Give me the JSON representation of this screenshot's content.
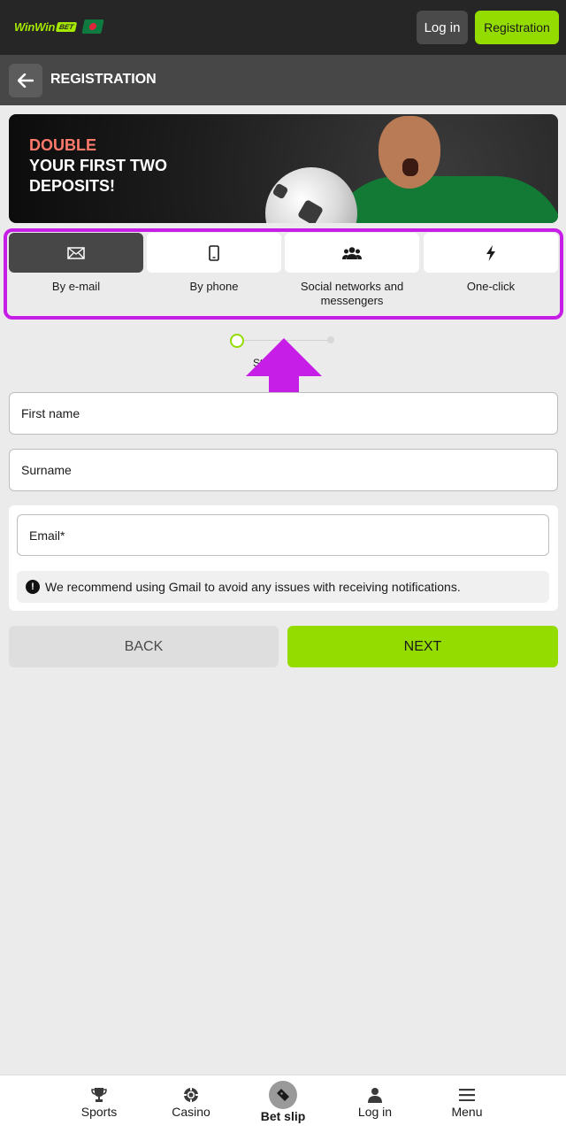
{
  "header": {
    "logo_text": "WinWin",
    "logo_badge": "BET",
    "login_label": "Log in",
    "register_label": "Registration"
  },
  "subheader": {
    "title": "REGISTRATION"
  },
  "banner": {
    "line1": "DOUBLE",
    "line2": "YOUR FIRST TWO",
    "line3": "DEPOSITS!"
  },
  "registration_types": [
    {
      "label": "By e-mail",
      "icon": "envelope-icon",
      "active": true
    },
    {
      "label": "By phone",
      "icon": "phone-icon",
      "active": false
    },
    {
      "label": "Social networks and messengers",
      "icon": "users-icon",
      "active": false
    },
    {
      "label": "One-click",
      "icon": "lightning-icon",
      "active": false
    }
  ],
  "steps": {
    "text": "Step 1 of 3"
  },
  "form": {
    "first_name_placeholder": "First name",
    "surname_placeholder": "Surname",
    "email_placeholder": "Email*",
    "hint": "We recommend using Gmail to avoid any issues with receiving notifications."
  },
  "buttons": {
    "back": "BACK",
    "next": "NEXT"
  },
  "bottom_nav": [
    {
      "label": "Sports",
      "icon": "trophy-icon"
    },
    {
      "label": "Casino",
      "icon": "casino-chip-icon"
    },
    {
      "label": "Bet slip",
      "icon": "ticket-icon"
    },
    {
      "label": "Log in",
      "icon": "user-icon"
    },
    {
      "label": "Menu",
      "icon": "hamburger-icon"
    }
  ],
  "colors": {
    "accent": "#94dc00",
    "header_bg": "#262626",
    "annotation": "#c61ee6"
  }
}
